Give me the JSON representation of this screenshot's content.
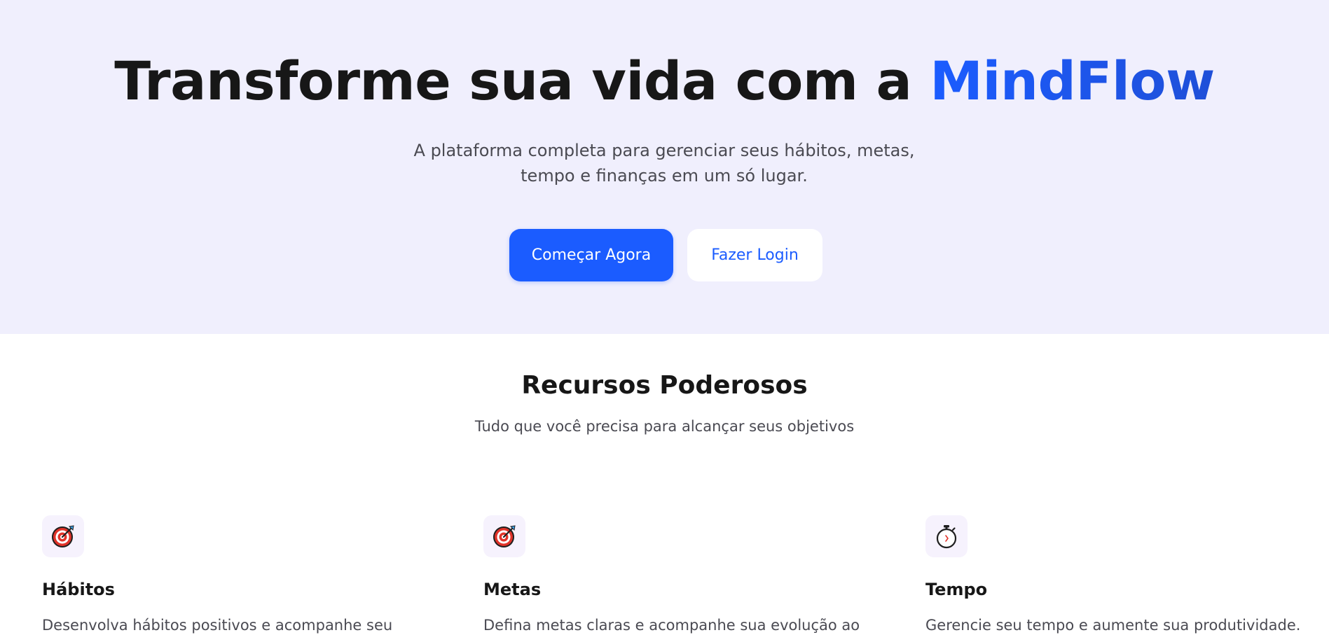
{
  "hero": {
    "title_prefix": "Transforme sua vida com a ",
    "title_brand": "MindFlow",
    "subtitle": "A plataforma completa para gerenciar seus hábitos, metas, tempo e finanças em um só lugar.",
    "primary_button": "Começar Agora",
    "secondary_button": "Fazer Login"
  },
  "features_section": {
    "title": "Recursos Poderosos",
    "subtitle": "Tudo que você precisa para alcançar seus objetivos"
  },
  "features": [
    {
      "icon": "target-icon",
      "title": "Hábitos",
      "description": "Desenvolva hábitos positivos e acompanhe seu"
    },
    {
      "icon": "target-icon",
      "title": "Metas",
      "description": "Defina metas claras e acompanhe sua evolução ao"
    },
    {
      "icon": "stopwatch-icon",
      "title": "Tempo",
      "description": "Gerencie seu tempo e aumente sua produtividade."
    }
  ],
  "colors": {
    "hero_background": "#f0effd",
    "accent": "#1b5cff",
    "icon_tile": "#f6f2fd"
  }
}
